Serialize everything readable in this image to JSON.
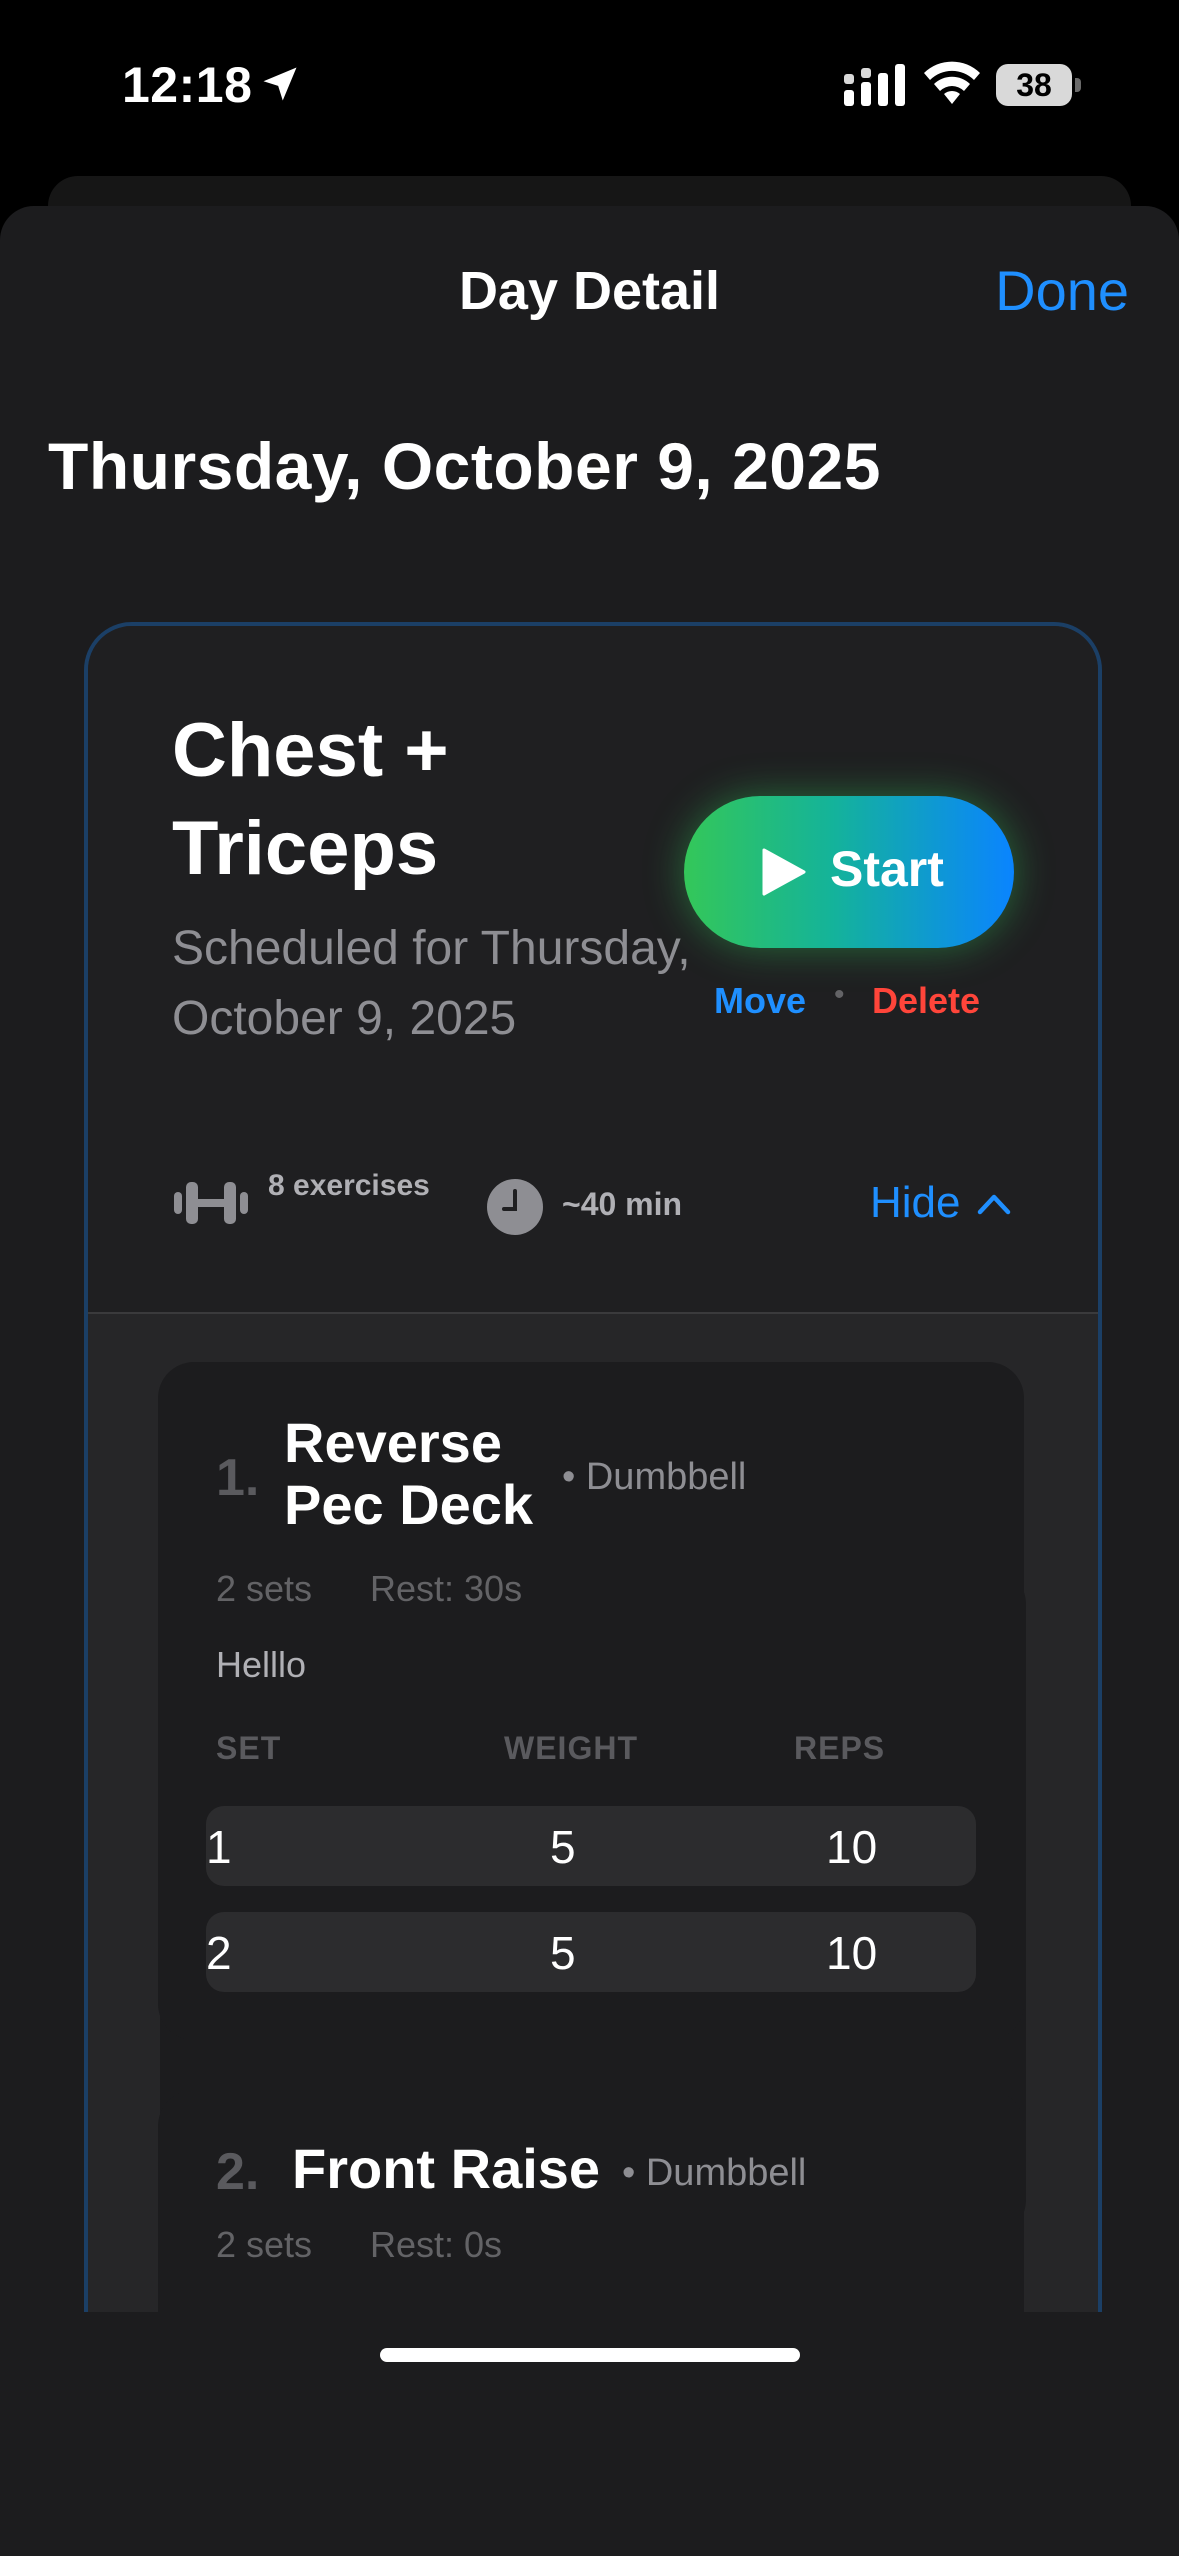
{
  "status_bar": {
    "time": "12:18",
    "battery": "38"
  },
  "nav": {
    "title": "Day Detail",
    "done_label": "Done"
  },
  "date_title": "Thursday, October 9, 2025",
  "workout": {
    "title": "Chest + Triceps",
    "schedule": "Scheduled for Thursday, October 9, 2025",
    "start_label": "Start",
    "move_label": "Move",
    "dot": "•",
    "delete_label": "Delete",
    "exercises_count": "8 exercises",
    "duration": "~40 min",
    "hide_label": "Hide"
  },
  "exercises": [
    {
      "number": "1.",
      "name": "Reverse Pec Deck",
      "equipment": "• Dumbbell",
      "sets": "2 sets",
      "rest": "Rest: 30s",
      "note": "Helllo",
      "columns": [
        "SET",
        "WEIGHT",
        "REPS"
      ],
      "rows": [
        {
          "set": "1",
          "weight": "5",
          "reps": "10"
        },
        {
          "set": "2",
          "weight": "5",
          "reps": "10"
        }
      ]
    },
    {
      "number": "2.",
      "name": "Front Raise",
      "equipment": "• Dumbbell",
      "sets": "2 sets",
      "rest": "Rest: 0s"
    }
  ],
  "colors": {
    "accent": "#1f8fff",
    "danger": "#ff453a",
    "start_gradient_from": "#34c759",
    "start_gradient_to": "#0a84ff"
  }
}
